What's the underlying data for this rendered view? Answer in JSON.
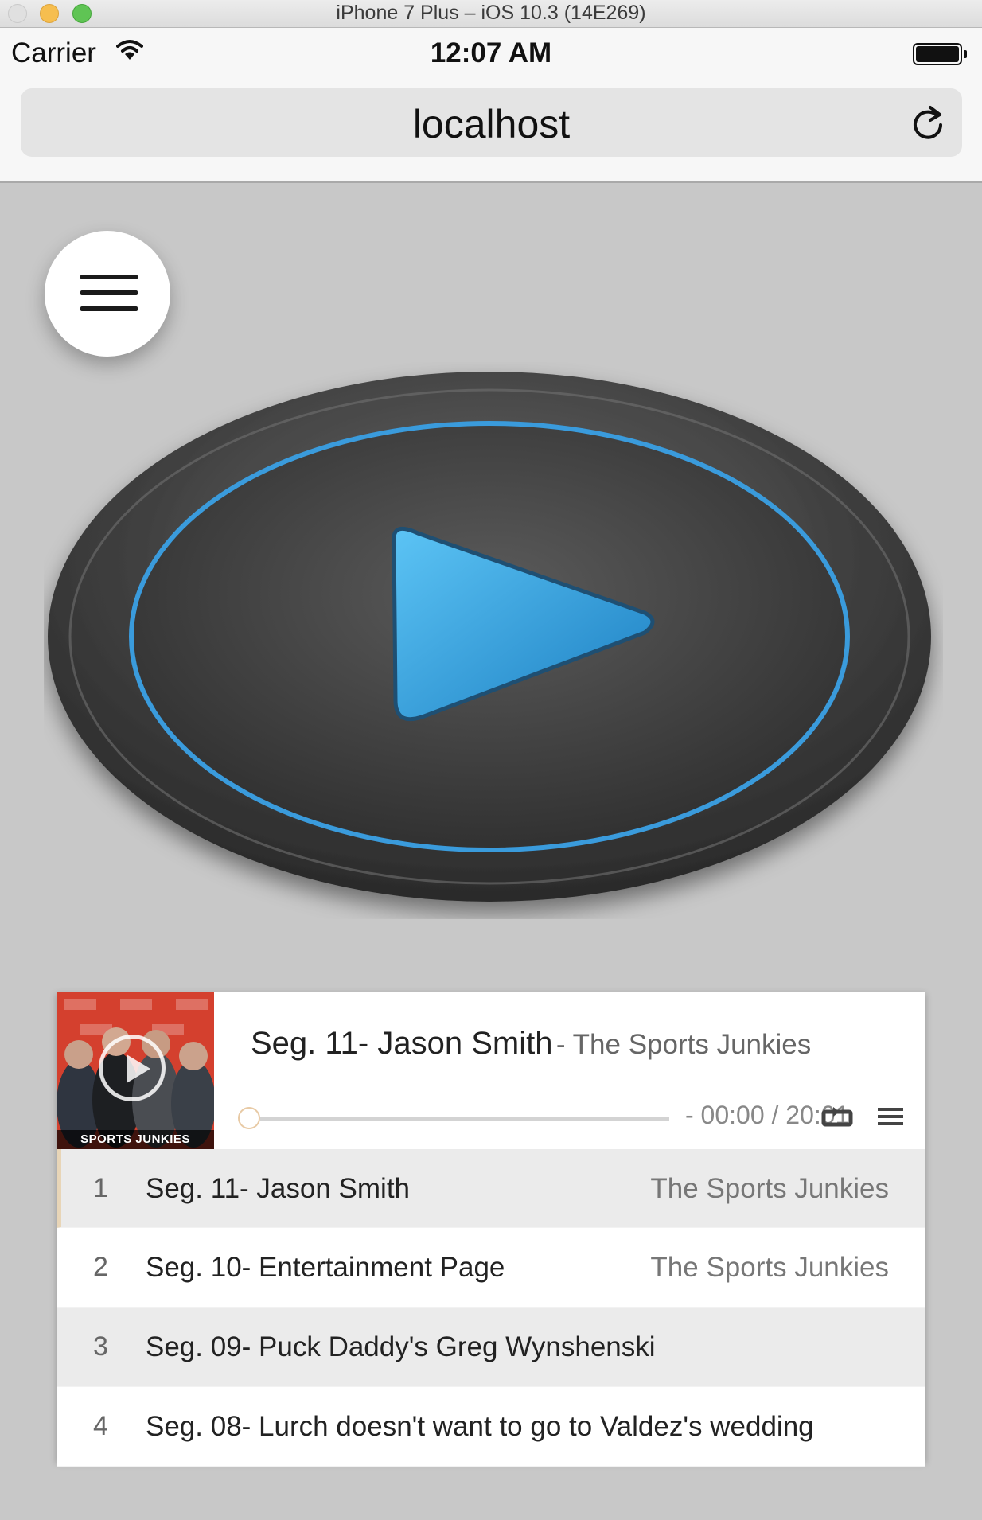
{
  "window": {
    "title": "iPhone 7 Plus – iOS 10.3 (14E269)"
  },
  "status_bar": {
    "carrier": "Carrier",
    "time": "12:07 AM",
    "battery_level": 1.0
  },
  "browser": {
    "url": "localhost",
    "reload_icon": "reload-icon"
  },
  "page": {
    "menu_icon": "hamburger-icon",
    "hero_icon": "play-icon",
    "background_color": "#c8c8c8",
    "accent_color": "#3a9bdc"
  },
  "player": {
    "cover_caption": "SPORTS JUNKIES",
    "current": {
      "title": "Seg. 11- Jason Smith",
      "artist": "- The Sports Junkies"
    },
    "time": "- 00:00 / 20:01",
    "progress": 0,
    "repeat_icon": "repeat-icon",
    "list_icon": "playlist-icon"
  },
  "playlist": [
    {
      "num": "1",
      "title": "Seg. 11- Jason Smith",
      "artist": "The Sports Junkies",
      "active": true
    },
    {
      "num": "2",
      "title": "Seg. 10- Entertainment Page",
      "artist": "The Sports Junkies",
      "active": false
    },
    {
      "num": "3",
      "title": "Seg. 09- Puck Daddy's Greg Wynshenski",
      "artist": "",
      "active": false
    },
    {
      "num": "4",
      "title": "Seg. 08- Lurch doesn't want to go to Valdez's wedding",
      "artist": "",
      "active": false
    }
  ]
}
